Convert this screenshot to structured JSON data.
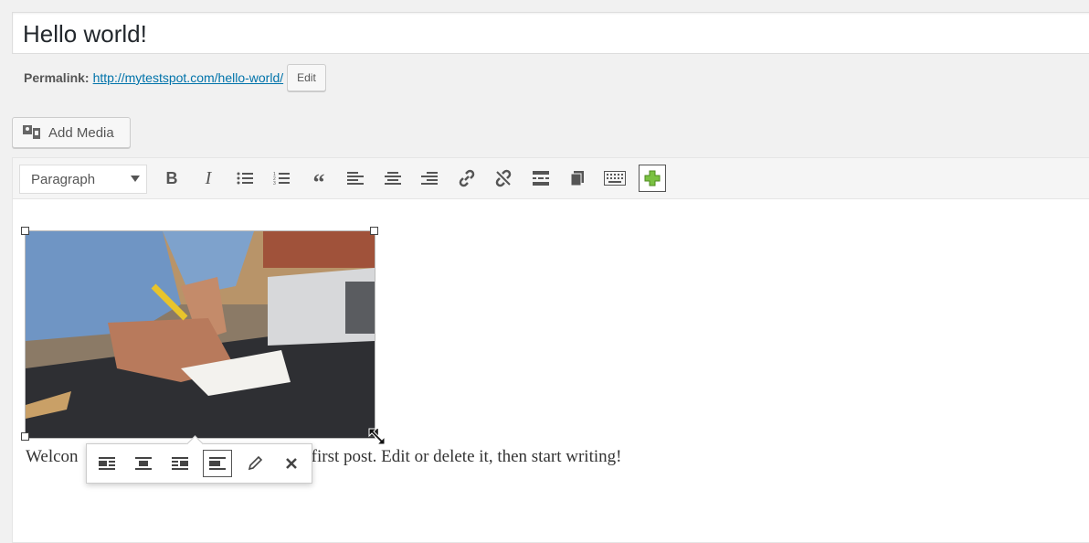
{
  "post": {
    "title": "Hello world!"
  },
  "permalink": {
    "label": "Permalink:",
    "url": "http://mytestspot.com/hello-world/",
    "edit_label": "Edit"
  },
  "media": {
    "add_label": "Add Media"
  },
  "toolbar": {
    "format_value": "Paragraph",
    "buttons": [
      "bold",
      "italic",
      "bulleted-list",
      "numbered-list",
      "blockquote",
      "align-left",
      "align-center",
      "align-right",
      "insert-link",
      "remove-link",
      "read-more",
      "toolbar-toggle",
      "keyboard",
      "add"
    ]
  },
  "content": {
    "paragraph_start": "Welcon",
    "paragraph_end": "r first post. Edit or delete it, then start writing!",
    "image_alt": "Person writing notes next to a laptop"
  },
  "image_toolbar": {
    "buttons": [
      "align-left",
      "align-center",
      "align-right",
      "align-none",
      "edit",
      "remove"
    ]
  },
  "colors": {
    "link": "#0073aa",
    "accent_plus": "#7ac142"
  }
}
